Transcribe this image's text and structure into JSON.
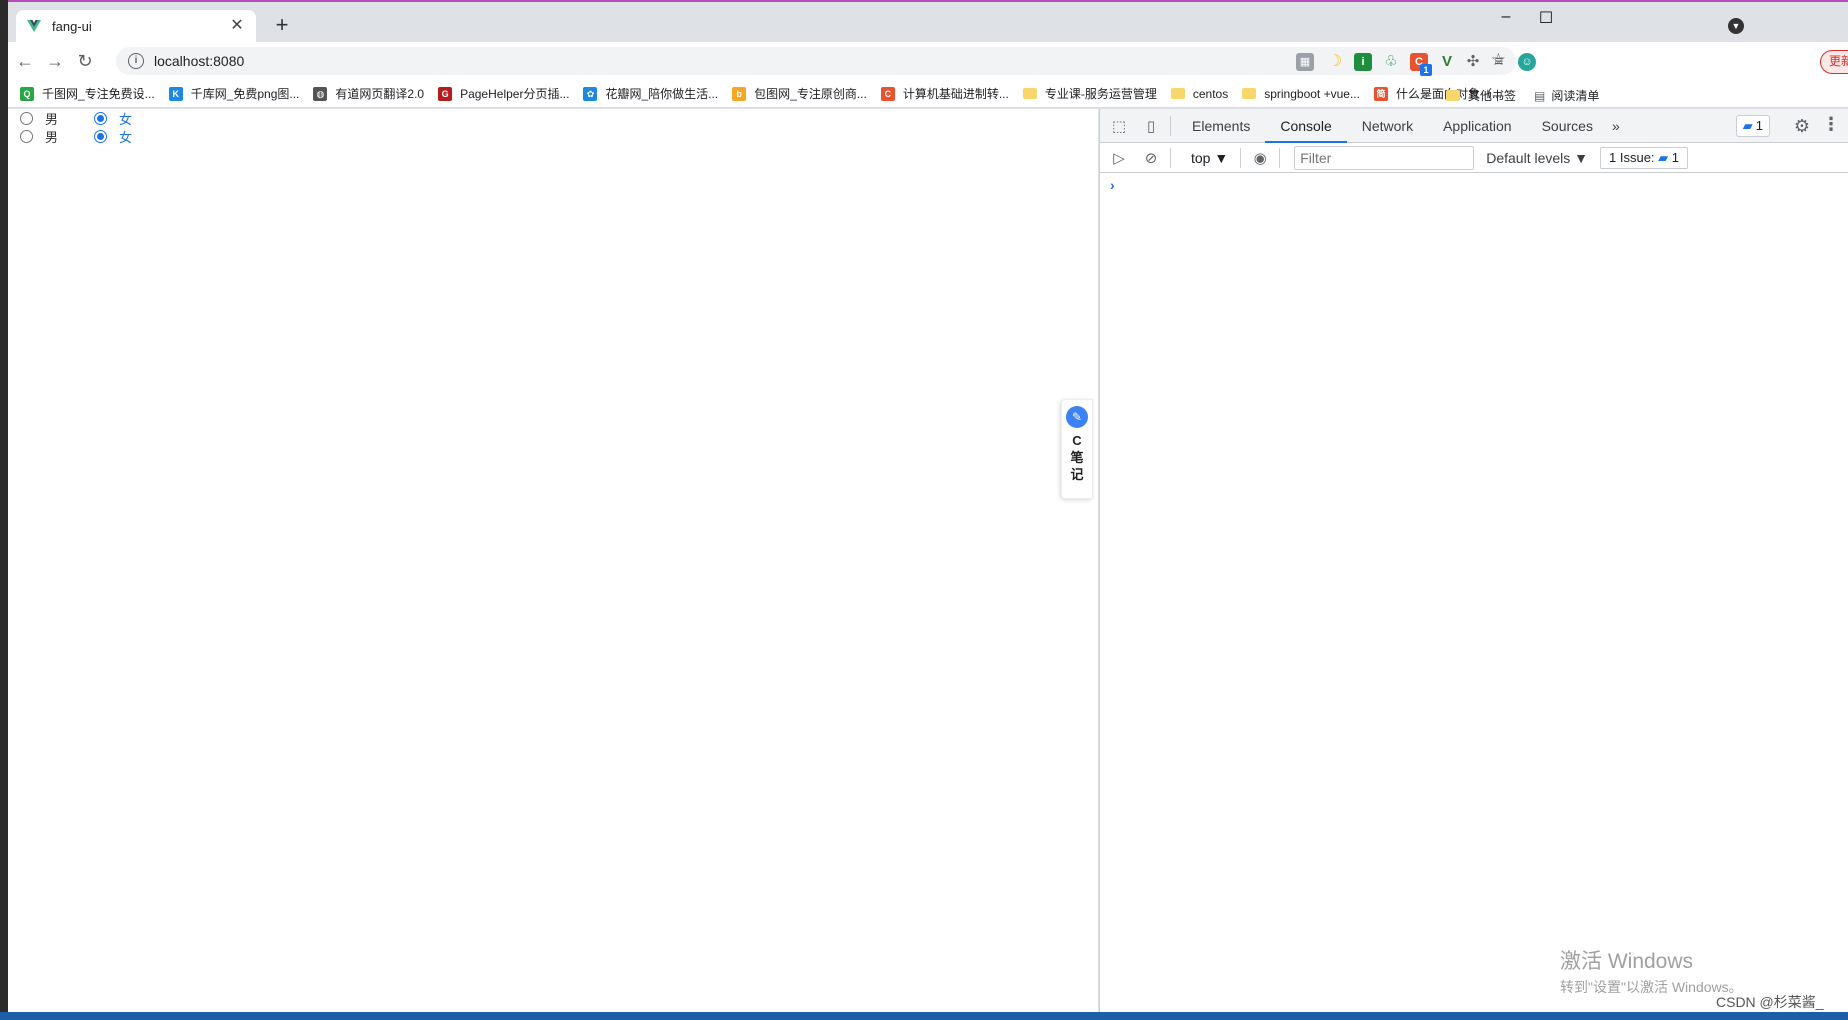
{
  "tab": {
    "title": "fang-ui",
    "close": "✕"
  },
  "newtab": "+",
  "window": {
    "minimize": "–",
    "maximize": "☐"
  },
  "toolbar": {
    "url": "localhost:8080"
  },
  "extensions": {
    "update_label": "更新",
    "badge_count": "1"
  },
  "bookmarks": [
    {
      "label": "千图网_专注免费设...",
      "icon": "qiantu-icon",
      "color": "#27a844",
      "glyph": "Q"
    },
    {
      "label": "千库网_免费png图...",
      "icon": "qianku-icon",
      "color": "#1e88e5",
      "glyph": "K"
    },
    {
      "label": "有道网页翻译2.0",
      "icon": "globe-icon",
      "color": "#555555",
      "glyph": "◍"
    },
    {
      "label": "PageHelper分页插...",
      "icon": "pagehelper-icon",
      "color": "#b71c1c",
      "glyph": "G"
    },
    {
      "label": "花瓣网_陪你做生活...",
      "icon": "huaban-icon",
      "color": "#1e88e5",
      "glyph": "✿"
    },
    {
      "label": "包图网_专注原创商...",
      "icon": "baotu-icon",
      "color": "#f5a623",
      "glyph": "b"
    },
    {
      "label": "计算机基础进制转...",
      "icon": "csdn-icon",
      "color": "#e8522e",
      "glyph": "C"
    },
    {
      "label": "专业课-服务运营管理",
      "icon": "folder-icon",
      "folder": true
    },
    {
      "label": "centos",
      "icon": "folder-icon",
      "folder": true
    },
    {
      "label": "springboot +vue...",
      "icon": "folder-icon",
      "folder": true
    },
    {
      "label": "什么是面向对象（...",
      "icon": "jianshu-icon",
      "color": "#e8522e",
      "glyph": "简"
    }
  ],
  "bookmarks_more": "»",
  "other_bookmarks": "其他书签",
  "reading_list": "阅读清单",
  "radios": [
    {
      "male": "男",
      "female": "女"
    },
    {
      "male": "男",
      "female": "女"
    }
  ],
  "note_widget": {
    "c": "C",
    "line1": "笔",
    "line2": "记"
  },
  "devtools": {
    "tabs": [
      "Elements",
      "Console",
      "Network",
      "Application",
      "Sources"
    ],
    "active_tab": "Console",
    "more_tabs": "»",
    "issues_badge": "1",
    "context": "top ▼",
    "filter_placeholder": "Filter",
    "levels": "Default levels ▼",
    "issue_label": "1 Issue:",
    "issue_count": "1",
    "prompt": "›"
  },
  "watermark": {
    "line1": "激活 Windows",
    "line2": "转到\"设置\"以激活 Windows。"
  },
  "csdn": "CSDN @杉菜酱_"
}
